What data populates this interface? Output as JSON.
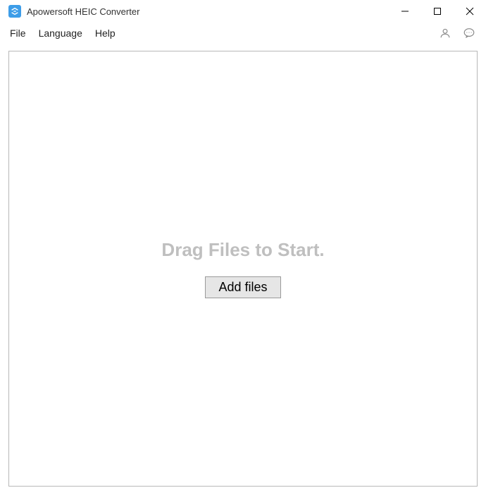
{
  "titlebar": {
    "title": "Apowersoft HEIC Converter"
  },
  "menubar": {
    "file": "File",
    "language": "Language",
    "help": "Help"
  },
  "main": {
    "drop_text": "Drag Files to Start.",
    "add_files_label": "Add files"
  }
}
